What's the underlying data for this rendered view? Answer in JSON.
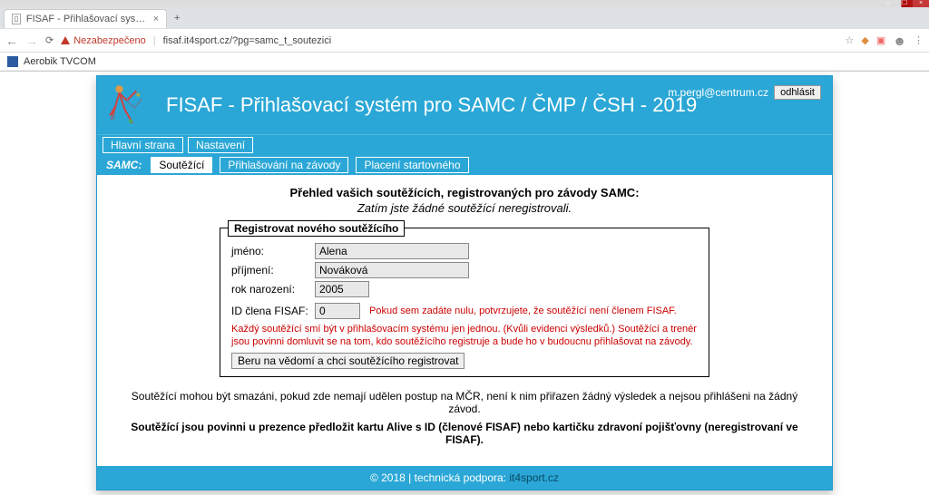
{
  "browser": {
    "tab_title": "FISAF - Přihlašovací systém pro ...",
    "security_warning": "Nezabezpečeno",
    "url": "fisaf.it4sport.cz/?pg=samc_t_soutezici",
    "bookmark": "Aerobik TVCOM"
  },
  "header": {
    "title": "FISAF - Přihlašovací systém pro SAMC / ČMP / ČSH - 2019",
    "user_email": "m.pergl@centrum.cz",
    "logout_label": "odhlásit"
  },
  "nav1": {
    "home": "Hlavní strana",
    "settings": "Nastavení"
  },
  "nav2": {
    "section_label": "SAMC:",
    "competitors": "Soutěžící",
    "register_races": "Přihlašování na závody",
    "payments": "Placení startovného"
  },
  "content": {
    "heading": "Přehled vašich soutěžících, registrovaných pro závody SAMC:",
    "subheading": "Zatím jste žádné soutěžící neregistrovali."
  },
  "form": {
    "legend": "Registrovat nového soutěžícího",
    "label_firstname": "jméno:",
    "value_firstname": "Alena",
    "label_lastname": "příjmení:",
    "value_lastname": "Nováková",
    "label_birthyear": "rok narození:",
    "value_birthyear": "2005",
    "label_fisaf_id": "ID člena FISAF:",
    "value_fisaf_id": "0",
    "warn_fisaf_zero": "Pokud sem zadáte nulu, potvrzujete, že soutěžící není členem FISAF.",
    "warn_block": "Každý soutěžící smí být v přihlašovacím systému jen jednou. (Kvůli evidenci výsledků.) Soutěžící a trenér jsou povinni domluvit se na tom, kdo soutěžícího registruje a bude ho v budoucnu přihlašovat na závody.",
    "submit_label": "Beru na vědomí a chci soutěžícího registrovat"
  },
  "notes": {
    "note1": "Soutěžící mohou být smazáni, pokud zde nemají udělen postup na MČR, není k nim přiřazen žádný výsledek a nejsou přihlášeni na žádný závod.",
    "note2": "Soutěžící jsou povinni u prezence předložit kartu Alive s ID (členové FISAF) nebo kartičku zdravoní pojišťovny (neregistrovaní ve FISAF)."
  },
  "footer": {
    "copyright": "© 2018 | technická podpora: ",
    "link": "it4sport.cz"
  }
}
